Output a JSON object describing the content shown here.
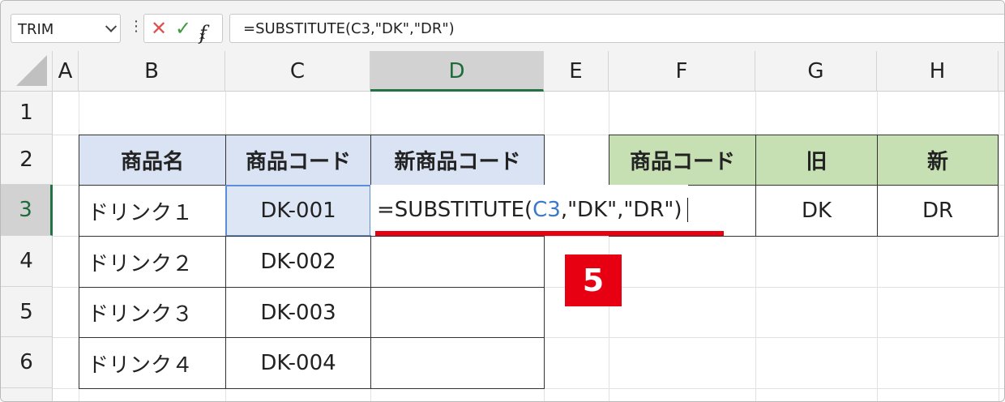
{
  "formula_bar": {
    "name_box": "TRIM",
    "cancel_icon": "✕",
    "enter_icon": "✓",
    "fx_label": "f",
    "fx_sub": "x",
    "formula": "=SUBSTITUTE(C3,\"DK\",\"DR\")"
  },
  "columns": [
    "A",
    "B",
    "C",
    "D",
    "E",
    "F",
    "G",
    "H"
  ],
  "rows": [
    "1",
    "2",
    "3",
    "4",
    "5",
    "6"
  ],
  "table1": {
    "headers": [
      "商品名",
      "商品コード",
      "新商品コード"
    ],
    "rows": [
      {
        "name": "ドリンク１",
        "code": "DK-001"
      },
      {
        "name": "ドリンク２",
        "code": "DK-002"
      },
      {
        "name": "ドリンク３",
        "code": "DK-003"
      },
      {
        "name": "ドリンク４",
        "code": "DK-004"
      }
    ]
  },
  "edit": {
    "prefix": "=SUBSTITUTE(",
    "ref": "C3",
    "suffix": ",\"DK\",\"DR\")"
  },
  "table2": {
    "headers": [
      "商品コード",
      "旧",
      "新"
    ],
    "old": "DK",
    "new": "DR"
  },
  "annotation": {
    "step": "5"
  },
  "colors": {
    "accent_red": "#e60012",
    "header_blue": "#dae3f3",
    "header_green": "#c6e0b4",
    "select_green": "#217346"
  }
}
